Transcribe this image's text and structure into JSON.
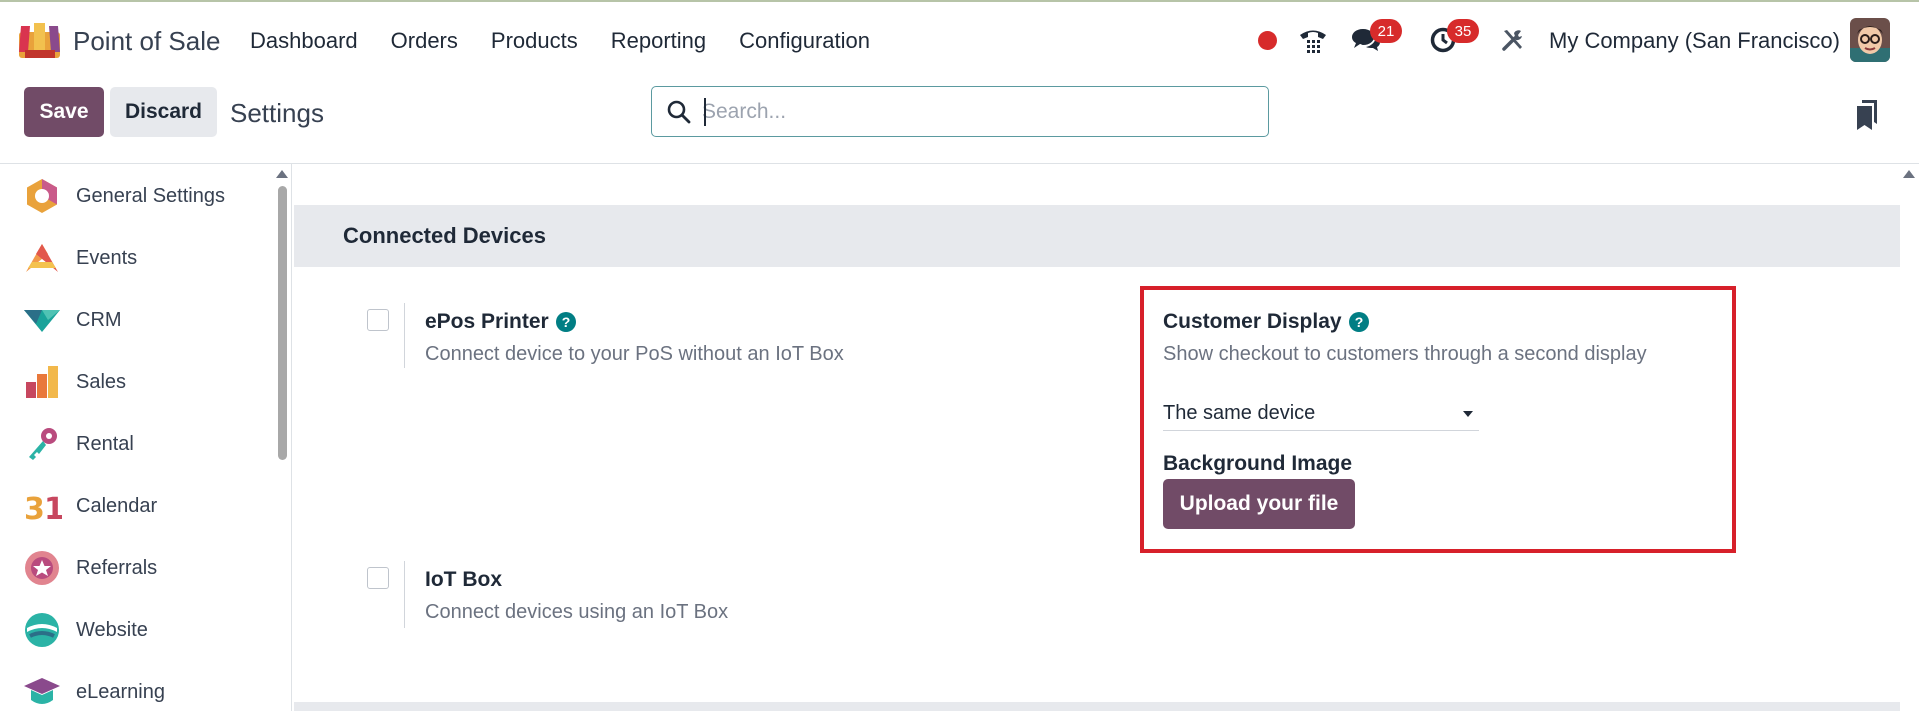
{
  "navbar": {
    "app_name": "Point of Sale",
    "menu": [
      "Dashboard",
      "Orders",
      "Products",
      "Reporting",
      "Configuration"
    ],
    "messages_badge": "21",
    "activities_badge": "35",
    "company": "My Company (San Francisco)"
  },
  "control_panel": {
    "save_label": "Save",
    "discard_label": "Discard",
    "title": "Settings",
    "search_placeholder": "Search..."
  },
  "sidebar": {
    "items": [
      {
        "label": "General Settings",
        "icon": "general-settings-icon"
      },
      {
        "label": "Events",
        "icon": "events-icon"
      },
      {
        "label": "CRM",
        "icon": "crm-icon"
      },
      {
        "label": "Sales",
        "icon": "sales-icon"
      },
      {
        "label": "Rental",
        "icon": "rental-icon"
      },
      {
        "label": "Calendar",
        "icon": "calendar-icon"
      },
      {
        "label": "Referrals",
        "icon": "referrals-icon"
      },
      {
        "label": "Website",
        "icon": "website-icon"
      },
      {
        "label": "eLearning",
        "icon": "elearning-icon"
      }
    ]
  },
  "main": {
    "section_title": "Connected Devices",
    "epos": {
      "title": "ePos Printer",
      "description": "Connect device to your PoS without an IoT Box",
      "checked": false
    },
    "customer_display": {
      "title": "Customer Display",
      "description": "Show checkout to customers through a second display",
      "select_value": "The same device",
      "background_label": "Background Image",
      "upload_label": "Upload your file"
    },
    "iot": {
      "title": "IoT Box",
      "description": "Connect devices using an IoT Box",
      "checked": false
    }
  },
  "colors": {
    "brand": "#714b67",
    "highlight": "#d7202a",
    "help": "#017e84",
    "badge": "#d72b2b"
  }
}
